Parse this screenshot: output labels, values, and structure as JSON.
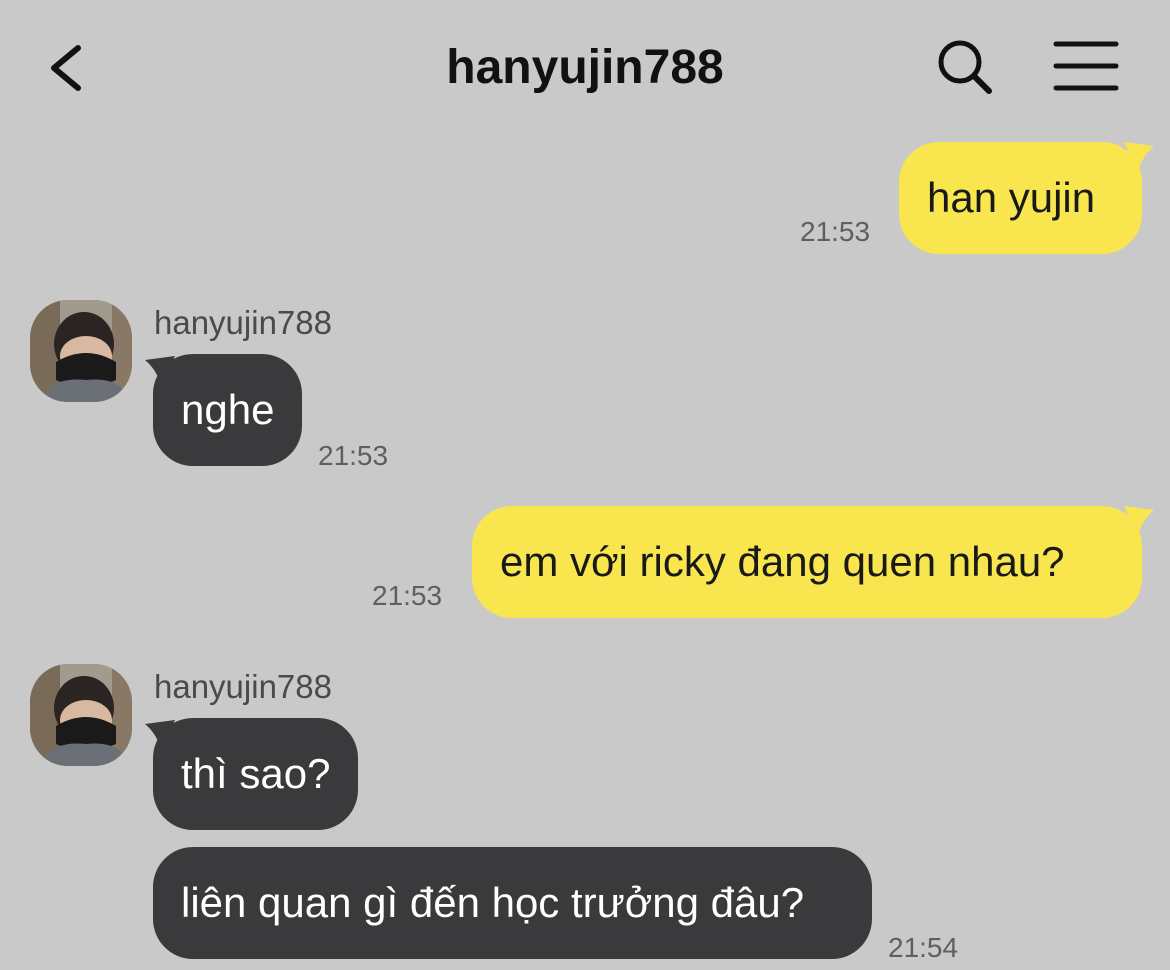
{
  "header": {
    "title": "hanyujin788",
    "back_icon": "chevron-left-icon",
    "search_icon": "search-icon",
    "menu_icon": "menu-icon"
  },
  "colors": {
    "background": "#c9c9c9",
    "outgoing_bubble": "#f9e64f",
    "incoming_bubble": "#3a3a3c"
  },
  "messages": [
    {
      "direction": "out",
      "text": "han yujin",
      "time": "21:53"
    },
    {
      "direction": "in",
      "sender": "hanyujin788",
      "text": "nghe",
      "time": "21:53"
    },
    {
      "direction": "out",
      "text": "em với ricky đang quen nhau?",
      "time": "21:53"
    },
    {
      "direction": "in",
      "sender": "hanyujin788",
      "text": "thì sao?"
    },
    {
      "direction": "in",
      "text": "liên quan gì đến học trưởng đâu?",
      "time": "21:54"
    }
  ]
}
